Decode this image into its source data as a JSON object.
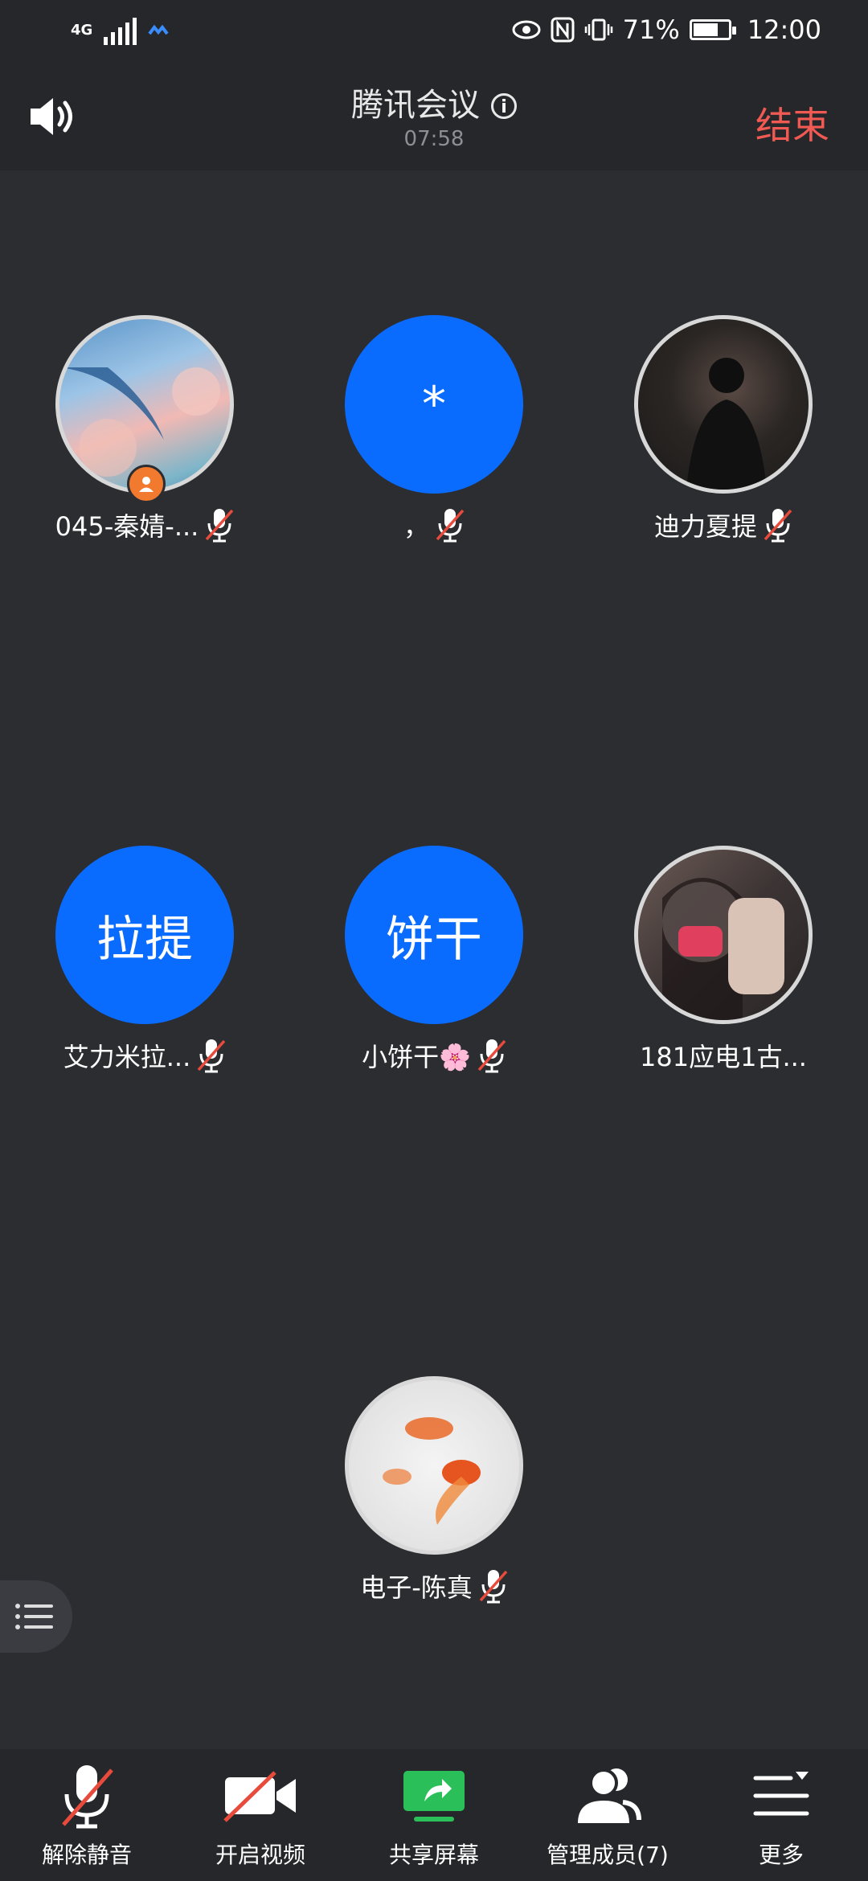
{
  "status": {
    "network": "4G",
    "battery": "71%",
    "time": "12:00",
    "battery_level": 0.71
  },
  "header": {
    "title": "腾讯会议",
    "timer": "07:58",
    "end_label": "结束"
  },
  "participants": [
    {
      "name": "045-秦婧-...",
      "avatar_text": "",
      "muted": true,
      "host": true
    },
    {
      "name": "，",
      "avatar_text": "*",
      "muted": true,
      "host": false
    },
    {
      "name": "迪力夏提",
      "avatar_text": "",
      "muted": true,
      "host": false
    },
    {
      "name": "艾力米拉...",
      "avatar_text": "拉提",
      "muted": true,
      "host": false
    },
    {
      "name": "小饼干🌸",
      "avatar_text": "饼干",
      "muted": true,
      "host": false
    },
    {
      "name": "181应电1古...",
      "avatar_text": "",
      "muted": false,
      "host": false
    },
    {
      "name": "电子-陈真",
      "avatar_text": "",
      "muted": true,
      "host": false
    }
  ],
  "toolbar": {
    "unmute": "解除静音",
    "video": "开启视频",
    "share": "共享屏幕",
    "members": "管理成员(7)",
    "more": "更多"
  },
  "colors": {
    "accent_blue": "#0a6cff",
    "end_red": "#f05a52",
    "share_green": "#2bbf5a",
    "host_orange": "#f27a2e"
  },
  "icons": [
    "speaker-icon",
    "info-icon",
    "mic-muted-icon",
    "video-off-icon",
    "share-screen-icon",
    "members-icon",
    "more-icon",
    "list-icon",
    "host-icon"
  ]
}
